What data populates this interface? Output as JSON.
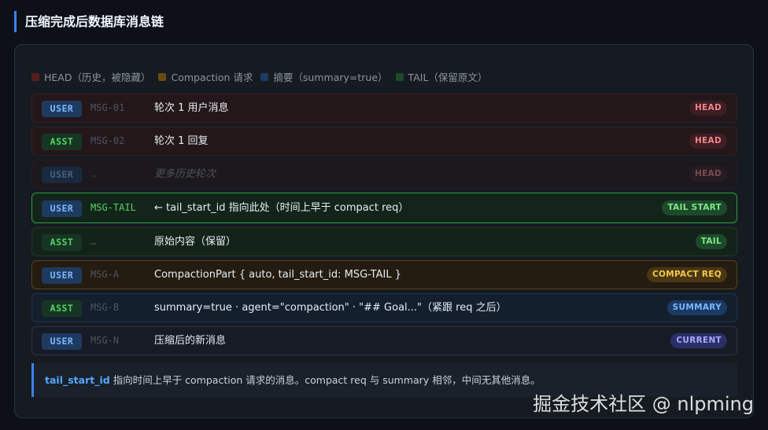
{
  "title": "压缩完成后数据库消息链",
  "legend": [
    {
      "label": "HEAD（历史，被隐藏）",
      "color": "#5a1d1d"
    },
    {
      "label": "Compaction 请求",
      "color": "#6b4a12"
    },
    {
      "label": "摘要（summary=true）",
      "color": "#1c3a63"
    },
    {
      "label": "TAIL（保留原文）",
      "color": "#1d4a2b"
    }
  ],
  "rows": [
    {
      "role": "USER",
      "id": "MSG-01",
      "content": "轮次 1 用户消息",
      "badge": "HEAD"
    },
    {
      "role": "ASST",
      "id": "MSG-02",
      "content": "轮次 1 回复",
      "badge": "HEAD"
    },
    {
      "role": "USER",
      "id": "…",
      "content": "更多历史轮次",
      "badge": "HEAD"
    },
    {
      "role": "USER",
      "id": "MSG-TAIL",
      "content": "← tail_start_id 指向此处（时间上早于 compact req）",
      "badge": "TAIL START"
    },
    {
      "role": "ASST",
      "id": "…",
      "content": "原始内容（保留）",
      "badge": "TAIL"
    },
    {
      "role": "USER",
      "id": "MSG-A",
      "content": "CompactionPart { auto, tail_start_id: MSG-TAIL }",
      "badge": "COMPACT REQ"
    },
    {
      "role": "ASST",
      "id": "MSG-B",
      "content": "summary=true · agent=\"compaction\" · \"## Goal...\"（紧跟 req 之后）",
      "badge": "SUMMARY"
    },
    {
      "role": "USER",
      "id": "MSG-N",
      "content": "压缩后的新消息",
      "badge": "CURRENT"
    }
  ],
  "note": {
    "key": "tail_start_id",
    "text": "指向时间上早于 compaction 请求的消息。compact req 与 summary 相邻，中间无其他消息。"
  },
  "watermark": "掘金技术社区 @ nlpming"
}
